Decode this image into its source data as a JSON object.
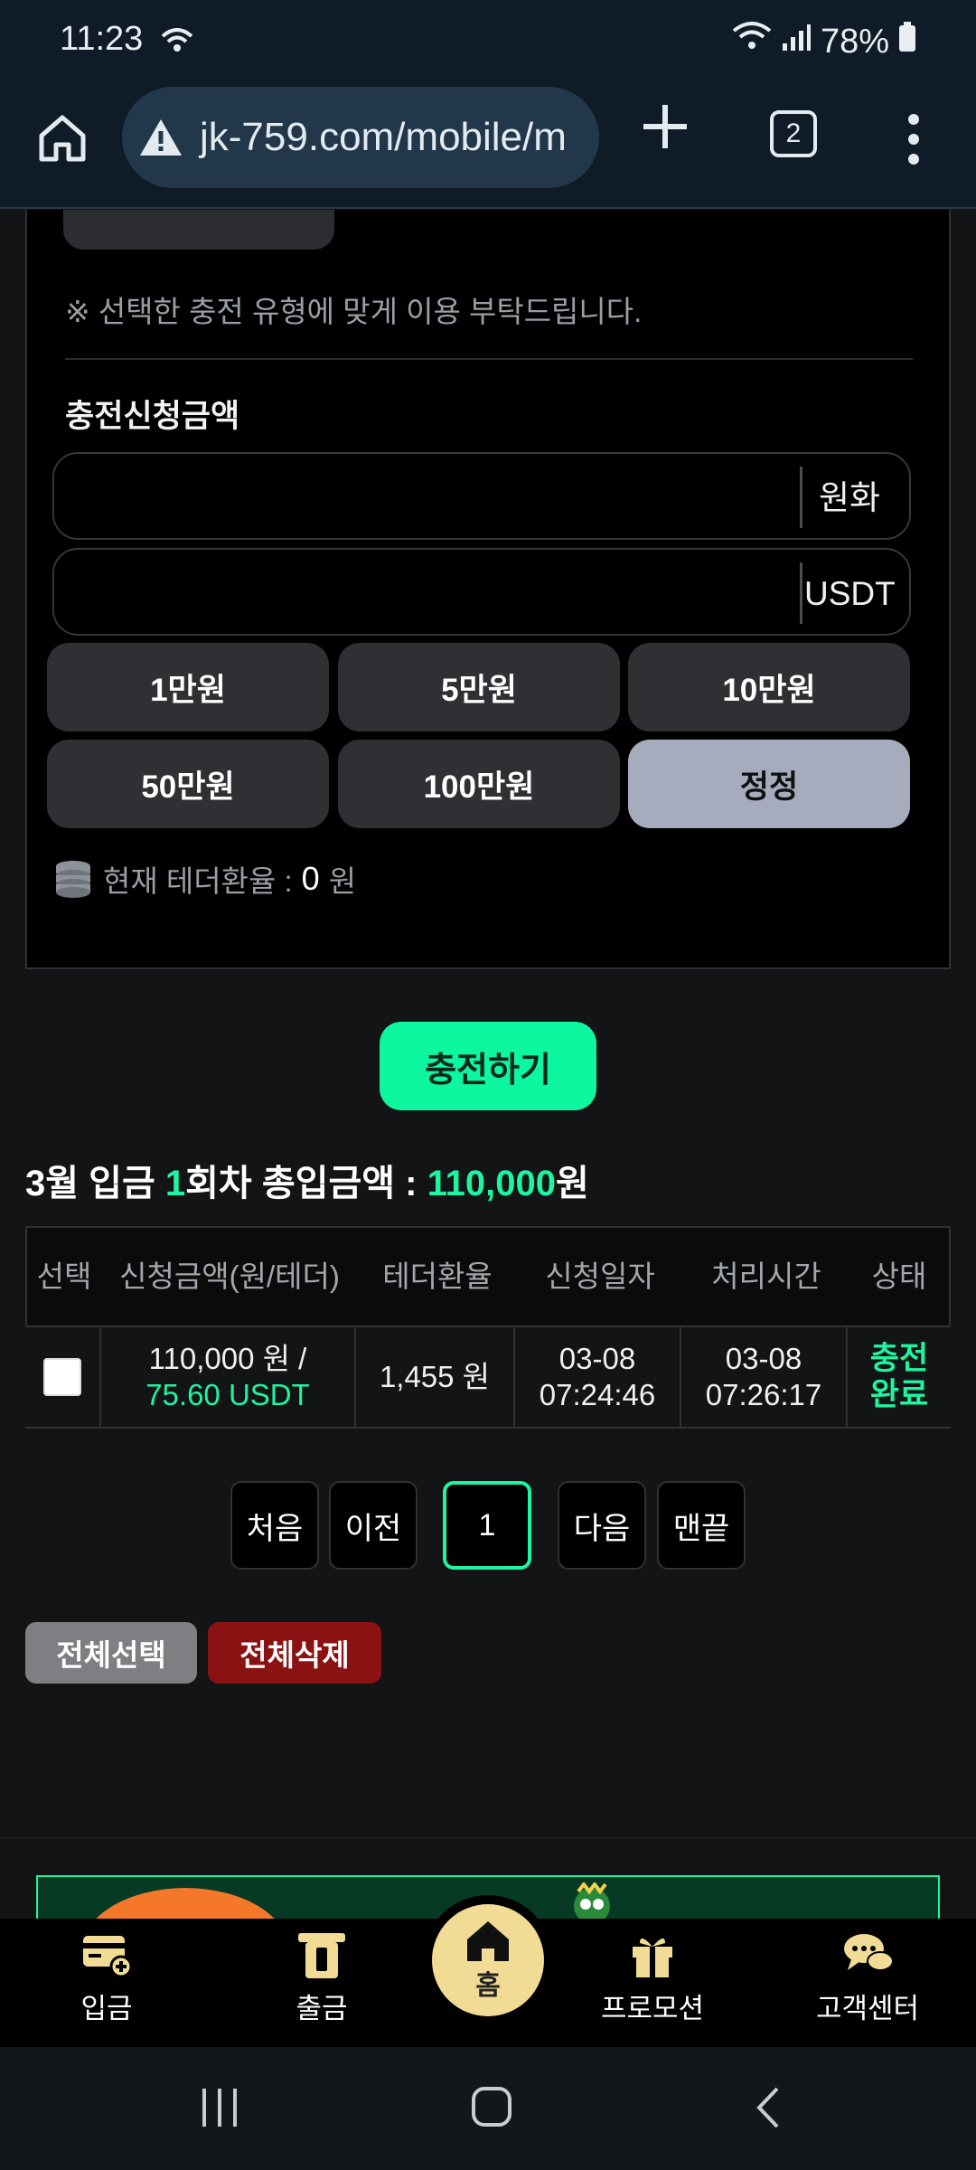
{
  "status_bar": {
    "time": "11:23",
    "battery": "78%"
  },
  "browser": {
    "url": "jk-759.com/mobile/m",
    "tab_count": "2"
  },
  "deposit_form": {
    "notice": "※ 선택한 충전 유형에 맞게 이용 부탁드립니다.",
    "amount_label": "충전신청금액",
    "krw_unit": "원화",
    "usdt_unit": "USDT",
    "krw_value": "",
    "usdt_value": "",
    "amount_buttons": [
      "1만원",
      "5만원",
      "10만원",
      "50만원",
      "100만원",
      "정정"
    ],
    "rate_label": "현재 테더환율 :",
    "rate_value": "0",
    "rate_unit": "원",
    "submit_label": "충전하기"
  },
  "summary": {
    "prefix": "3월 입금 ",
    "count": "1",
    "middle": "회차 총입금액 : ",
    "total": "110,000",
    "suffix": "원"
  },
  "table": {
    "headers": [
      "선택",
      "신청금액(원/테더)",
      "테더환율",
      "신청일자",
      "처리시간",
      "상태"
    ],
    "rows": [
      {
        "amount_krw": "110,000 원 /",
        "amount_usdt": "75.60 USDT",
        "rate": "1,455 원",
        "request_date": "03-08",
        "request_time": "07:24:46",
        "process_date": "03-08",
        "process_time": "07:26:17",
        "status_line1": "충전",
        "status_line2": "완료"
      }
    ]
  },
  "pagination": {
    "first": "처음",
    "prev": "이전",
    "current": "1",
    "next": "다음",
    "last": "맨끝"
  },
  "actions": {
    "select_all": "전체선택",
    "delete_all": "전체삭제"
  },
  "bottom_nav": {
    "deposit": "입금",
    "withdraw": "출금",
    "home": "홈",
    "promotion": "프로모션",
    "support": "고객센터"
  },
  "colors": {
    "accent": "#1ef5a0",
    "danger": "#8b1212",
    "home": "#f2dc95"
  }
}
